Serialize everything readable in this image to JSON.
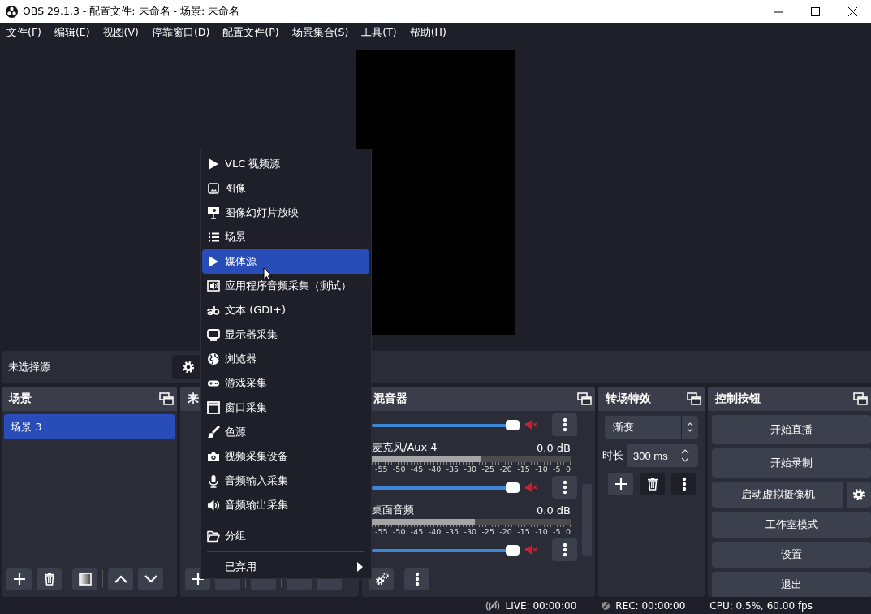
{
  "window": {
    "title": "OBS 29.1.3 - 配置文件: 未命名 - 场景: 未命名"
  },
  "menu_bar": [
    "文件(F)",
    "编辑(E)",
    "视图(V)",
    "停靠窗口(D)",
    "配置文件(P)",
    "场景集合(S)",
    "工具(T)",
    "帮助(H)"
  ],
  "source_toolbar": {
    "label": "未选择源"
  },
  "scenes_dock": {
    "title": "场景",
    "items": [
      {
        "label": "场景 3",
        "selected": true
      }
    ]
  },
  "sources_dock": {
    "title": "来"
  },
  "mixer_dock": {
    "title": "混音器",
    "channels": [
      {
        "volume": {
          "level": 1
        },
        "muted": true
      },
      {
        "name": "麦克风/Aux 4",
        "reading": "0.0 dB",
        "scale": [
          "-55",
          "-50",
          "-45",
          "-40",
          "-35",
          "-30",
          "-25",
          "-20",
          "-15",
          "-10",
          "-5",
          "0"
        ],
        "meter": {
          "level": 0.55
        },
        "volume": {
          "level": 1
        },
        "muted": true
      },
      {
        "name": "桌面音频",
        "reading": "0.0 dB",
        "scale": [
          "-55",
          "-50",
          "-45",
          "-40",
          "-35",
          "-30",
          "-25",
          "-20",
          "-15",
          "-10",
          "-5",
          "0"
        ],
        "meter": {
          "level": 0.52
        },
        "volume": {
          "level": 1
        },
        "muted": true
      }
    ]
  },
  "transitions_dock": {
    "title": "转场特效",
    "transition": "渐变",
    "duration_label": "时长",
    "duration": "300 ms"
  },
  "controls_dock": {
    "title": "控制按钮",
    "buttons": [
      {
        "label": "开始直播",
        "settings_button": false
      },
      {
        "label": "开始录制",
        "settings_button": false
      },
      {
        "label": "启动虚拟摄像机",
        "settings_button": true
      },
      {
        "label": "工作室模式",
        "settings_button": false
      },
      {
        "label": "设置",
        "settings_button": false
      },
      {
        "label": "退出",
        "settings_button": false
      }
    ]
  },
  "status_bar": {
    "live": "LIVE: 00:00:00",
    "rec": "REC: 00:00:00",
    "cpu": "CPU: 0.5%, 60.00 fps"
  },
  "context_menu": {
    "items": [
      {
        "kind": "play",
        "label": "VLC 视频源",
        "selected": false
      },
      {
        "kind": "image",
        "label": "图像",
        "selected": false
      },
      {
        "kind": "slideshow",
        "label": "图像幻灯片放映",
        "selected": false
      },
      {
        "kind": "list",
        "label": "场景",
        "selected": false
      },
      {
        "kind": "play",
        "label": "媒体源",
        "selected": true
      },
      {
        "kind": "app_audio",
        "label": "应用程序音频采集（测试）",
        "selected": false
      },
      {
        "kind": "text",
        "label": "文本 (GDI+)",
        "selected": false
      },
      {
        "kind": "monitor",
        "label": "显示器采集",
        "selected": false
      },
      {
        "kind": "globe",
        "label": "浏览器",
        "selected": false
      },
      {
        "kind": "gamepad",
        "label": "游戏采集",
        "selected": false
      },
      {
        "kind": "window",
        "label": "窗口采集",
        "selected": false
      },
      {
        "kind": "brush",
        "label": "色源",
        "selected": false
      },
      {
        "kind": "camera",
        "label": "视频采集设备",
        "selected": false
      },
      {
        "kind": "mic",
        "label": "音频输入采集",
        "selected": false
      },
      {
        "kind": "speaker",
        "label": "音频输出采集",
        "selected": false
      },
      {
        "kind": "separator"
      },
      {
        "kind": "folder",
        "label": "分组",
        "selected": false
      },
      {
        "kind": "separator"
      },
      {
        "kind": "submenu",
        "label": "已弃用",
        "selected": false
      }
    ]
  }
}
